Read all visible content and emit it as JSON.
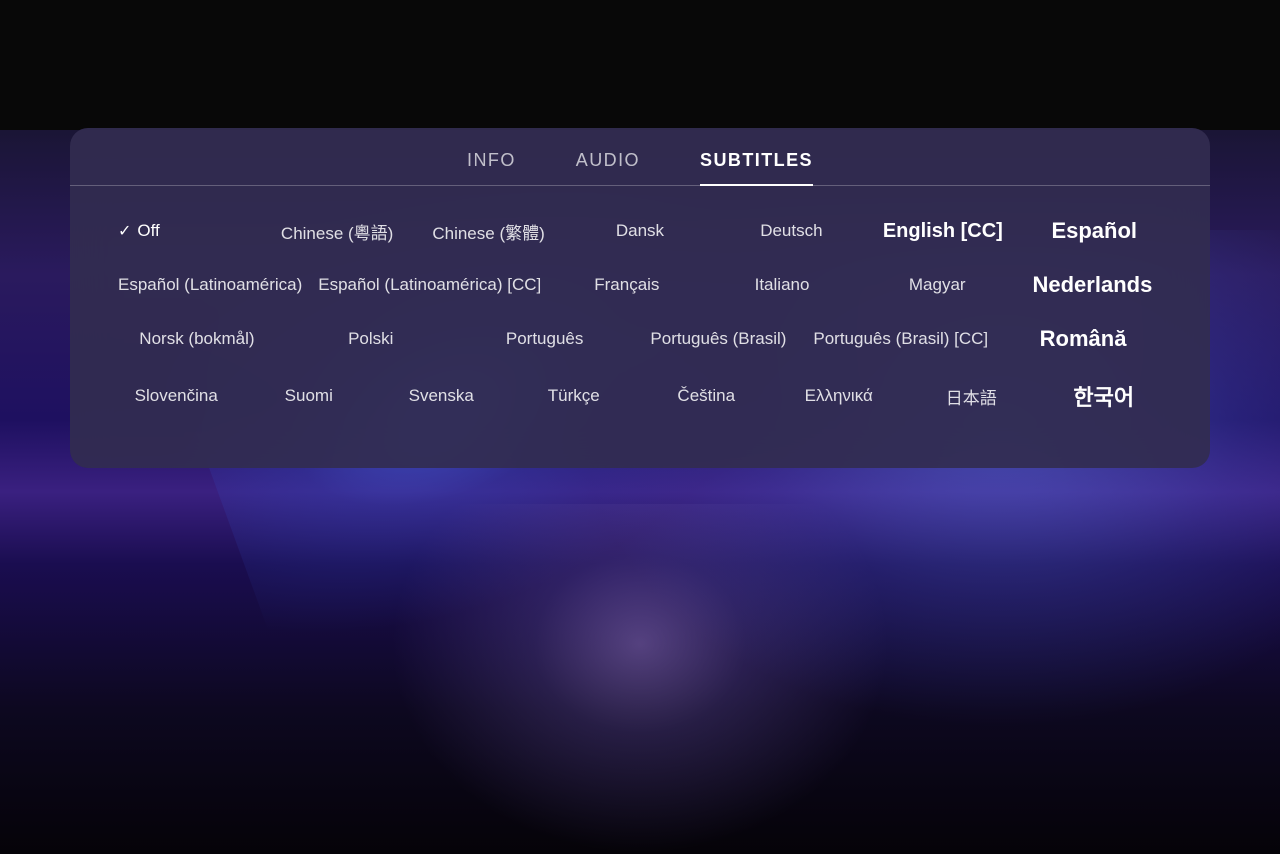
{
  "background": {
    "top_color": "#080808",
    "scene_color": "#1a1535"
  },
  "modal": {
    "tabs": [
      {
        "id": "info",
        "label": "INFO",
        "active": false
      },
      {
        "id": "audio",
        "label": "AUDIO",
        "active": false
      },
      {
        "id": "subtitles",
        "label": "SUBTITLES",
        "active": true
      }
    ],
    "subtitle_rows": [
      [
        {
          "id": "off",
          "label": "Off",
          "selected": true,
          "has_check": true,
          "size": "normal"
        },
        {
          "id": "chinese-cantonese",
          "label": "Chinese (粵語)",
          "selected": false,
          "has_check": false,
          "size": "normal"
        },
        {
          "id": "chinese-traditional",
          "label": "Chinese (繁體)",
          "selected": false,
          "has_check": false,
          "size": "normal"
        },
        {
          "id": "dansk",
          "label": "Dansk",
          "selected": false,
          "has_check": false,
          "size": "normal"
        },
        {
          "id": "deutsch",
          "label": "Deutsch",
          "selected": false,
          "has_check": false,
          "size": "normal"
        },
        {
          "id": "english-cc",
          "label": "English [CC]",
          "selected": false,
          "has_check": false,
          "size": "medium-large"
        },
        {
          "id": "espanol",
          "label": "Español",
          "selected": false,
          "has_check": false,
          "size": "large"
        }
      ],
      [
        {
          "id": "espanol-latin",
          "label": "Español (Latinoamérica)",
          "selected": false,
          "has_check": false,
          "size": "normal"
        },
        {
          "id": "espanol-latin-cc",
          "label": "Español (Latinoamérica) [CC]",
          "selected": false,
          "has_check": false,
          "size": "normal"
        },
        {
          "id": "francais",
          "label": "Français",
          "selected": false,
          "has_check": false,
          "size": "normal"
        },
        {
          "id": "italiano",
          "label": "Italiano",
          "selected": false,
          "has_check": false,
          "size": "normal"
        },
        {
          "id": "magyar",
          "label": "Magyar",
          "selected": false,
          "has_check": false,
          "size": "normal"
        },
        {
          "id": "nederlands",
          "label": "Nederlands",
          "selected": false,
          "has_check": false,
          "size": "large"
        }
      ],
      [
        {
          "id": "norsk",
          "label": "Norsk (bokmål)",
          "selected": false,
          "has_check": false,
          "size": "normal"
        },
        {
          "id": "polski",
          "label": "Polski",
          "selected": false,
          "has_check": false,
          "size": "normal"
        },
        {
          "id": "portugues",
          "label": "Português",
          "selected": false,
          "has_check": false,
          "size": "normal"
        },
        {
          "id": "portugues-brasil",
          "label": "Português (Brasil)",
          "selected": false,
          "has_check": false,
          "size": "normal"
        },
        {
          "id": "portugues-brasil-cc",
          "label": "Português (Brasil) [CC]",
          "selected": false,
          "has_check": false,
          "size": "normal"
        },
        {
          "id": "romana",
          "label": "Română",
          "selected": false,
          "has_check": false,
          "size": "large"
        }
      ],
      [
        {
          "id": "slovencina",
          "label": "Slovenčina",
          "selected": false,
          "has_check": false,
          "size": "normal"
        },
        {
          "id": "suomi",
          "label": "Suomi",
          "selected": false,
          "has_check": false,
          "size": "normal"
        },
        {
          "id": "svenska",
          "label": "Svenska",
          "selected": false,
          "has_check": false,
          "size": "normal"
        },
        {
          "id": "turkce",
          "label": "Türkçe",
          "selected": false,
          "has_check": false,
          "size": "normal"
        },
        {
          "id": "cestina",
          "label": "Čeština",
          "selected": false,
          "has_check": false,
          "size": "normal"
        },
        {
          "id": "ellinika",
          "label": "Ελληνικά",
          "selected": false,
          "has_check": false,
          "size": "normal"
        },
        {
          "id": "japanese",
          "label": "日本語",
          "selected": false,
          "has_check": false,
          "size": "normal"
        },
        {
          "id": "korean",
          "label": "한국어",
          "selected": false,
          "has_check": false,
          "size": "large"
        }
      ]
    ]
  }
}
